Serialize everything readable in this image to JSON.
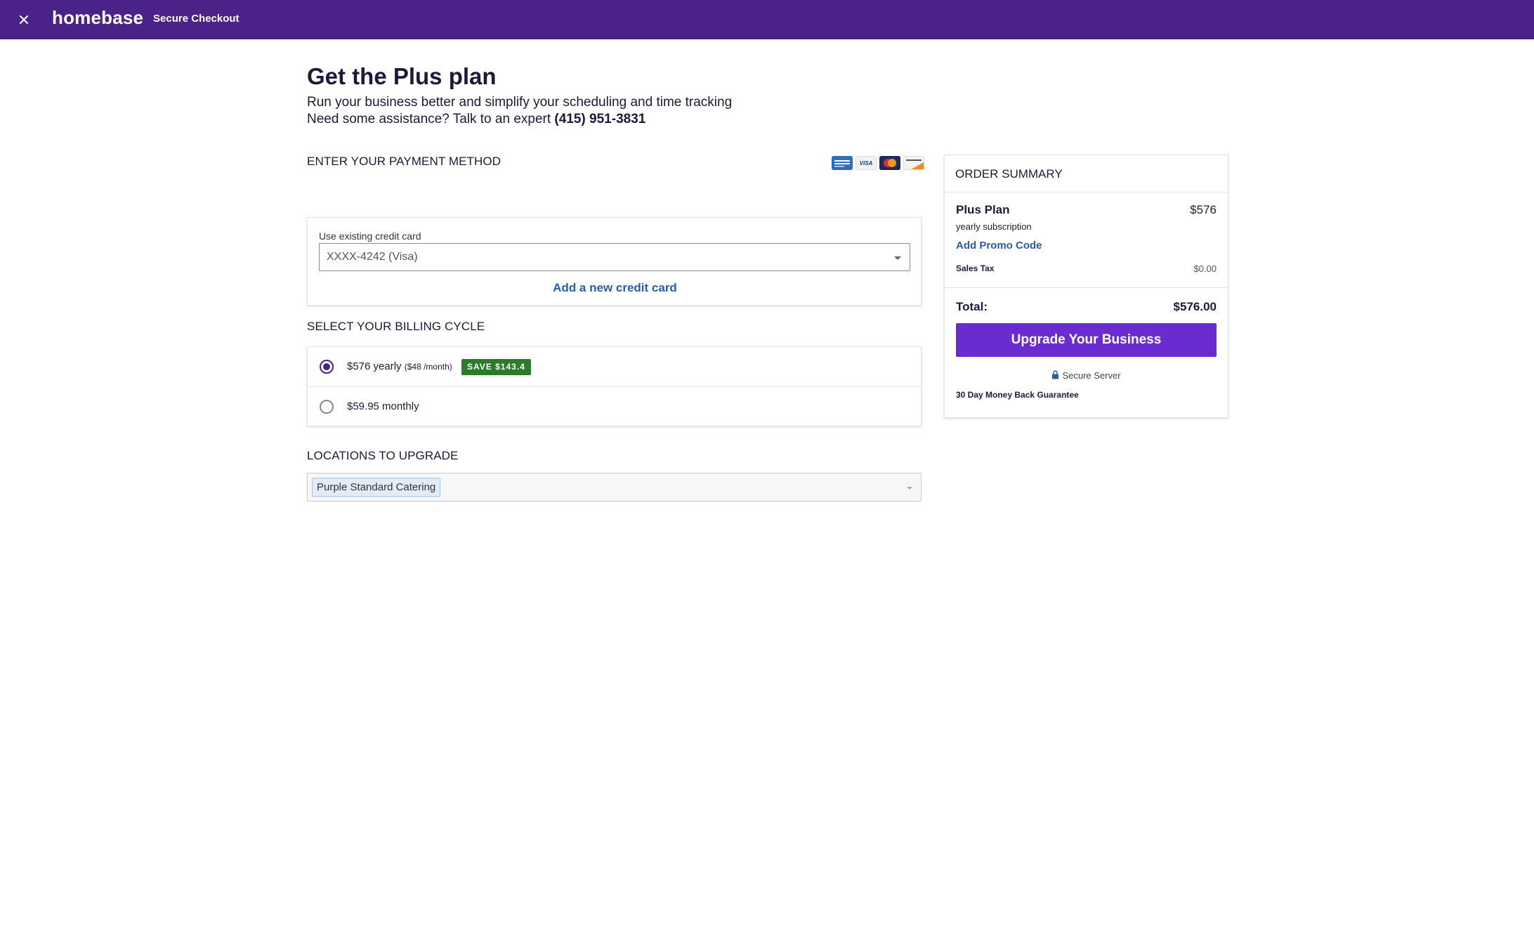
{
  "topbar": {
    "close_icon": "close-icon",
    "brand": "homebase",
    "checkout_label": "Secure Checkout",
    "background": "#4b2287"
  },
  "header": {
    "title": "Get the Plus plan",
    "subtitle": "Run your business better and simplify your scheduling and time tracking",
    "assist_text": "Need some assistance? Talk to an expert ",
    "phone": "(415) 951-3831"
  },
  "payment": {
    "section_label": "ENTER YOUR PAYMENT METHOD",
    "card_icons": [
      "amex-icon",
      "visa-icon",
      "mastercard-icon",
      "discover-icon"
    ],
    "existing_label": "Use existing credit card",
    "selected_card": "XXXX-4242 (Visa)",
    "add_card_label": "Add a new credit card"
  },
  "billing": {
    "section_label": "SELECT YOUR BILLING CYCLE",
    "options": [
      {
        "label": "$576 yearly",
        "detail": "($48 /month)",
        "badge": "SAVE $143.4",
        "selected": true
      },
      {
        "label": "$59.95 monthly",
        "detail": "",
        "badge": "",
        "selected": false
      }
    ]
  },
  "locations": {
    "section_label": "LOCATIONS TO UPGRADE",
    "selected": [
      "Purple Standard Catering"
    ]
  },
  "summary": {
    "title": "ORDER SUMMARY",
    "plan_name": "Plus Plan",
    "plan_price": "$576",
    "plan_sub": "yearly subscription",
    "promo_label": "Add Promo Code",
    "tax_label": "Sales Tax",
    "tax_value": "$0.00",
    "total_label": "Total:",
    "total_value": "$576.00",
    "upgrade_label": "Upgrade Your Business",
    "secure_label": "Secure Server",
    "guarantee": "30 Day Money Back Guarantee",
    "accent": "#6a2bd1"
  }
}
